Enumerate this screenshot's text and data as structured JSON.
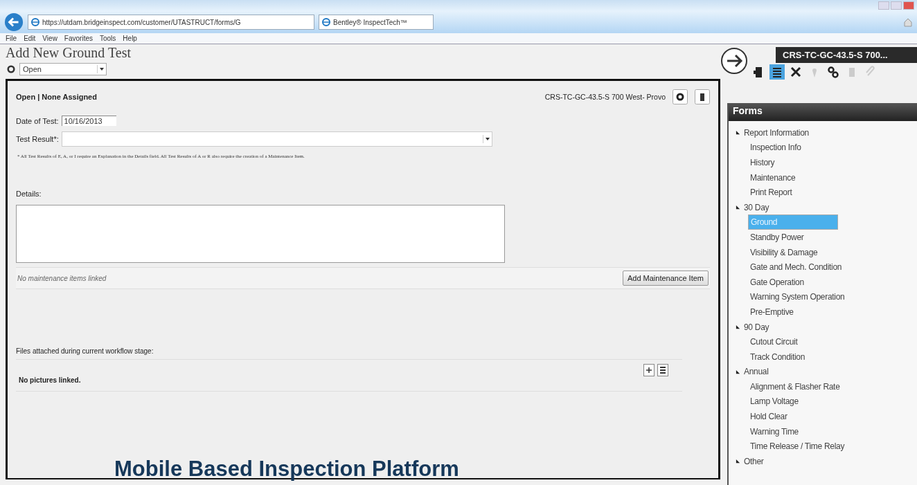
{
  "browser": {
    "address": "https://utdam.bridgeinspect.com/customer/UTASTRUCT/forms/G",
    "tab_title": "Bentley® InspectTech™",
    "menu": [
      "File",
      "Edit",
      "View",
      "Favorites",
      "Tools",
      "Help"
    ]
  },
  "page": {
    "title": "Add New Ground Test",
    "status_select": {
      "value": "Open"
    }
  },
  "form": {
    "status": "Open | None Assigned",
    "asset": "CRS-TC-GC-43.5-S 700 West- Provo",
    "date_label": "Date of Test:",
    "date_value": "10/16/2013",
    "result_label": "Test Result*:",
    "note": "* All Test Results of E, A, or I require an Explanation in the Details field. All Test Results of A or R also require the creation of a Maintenance Item.",
    "details_label": "Details:",
    "maintenance_empty": "No maintenance items linked",
    "add_button": "Add Maintenance Item",
    "files_label": "Files attached during current workflow stage:",
    "pictures_empty": "No pictures linked."
  },
  "sidebar": {
    "asset_title": "CRS-TC-GC-43.5-S 700...",
    "toolbar": [
      {
        "kind": "door",
        "selected": false
      },
      {
        "kind": "list",
        "selected": true
      },
      {
        "kind": "tools",
        "selected": false
      },
      {
        "kind": "pin",
        "selected": false
      },
      {
        "kind": "keys",
        "selected": false
      },
      {
        "kind": "trash",
        "selected": false
      },
      {
        "kind": "clip",
        "selected": false
      }
    ],
    "panel_title": "Forms",
    "tree": [
      {
        "label": "Report Information",
        "expanded": true,
        "children": [
          {
            "label": "Inspection Info",
            "selected": false
          },
          {
            "label": "History",
            "selected": false
          },
          {
            "label": "Maintenance",
            "selected": false
          },
          {
            "label": "Print Report",
            "selected": false
          }
        ]
      },
      {
        "label": "30 Day",
        "expanded": true,
        "children": [
          {
            "label": "Ground",
            "selected": true
          },
          {
            "label": "Standby Power",
            "selected": false
          },
          {
            "label": "Visibility & Damage",
            "selected": false
          },
          {
            "label": "Gate and Mech. Condition",
            "selected": false
          },
          {
            "label": "Gate Operation",
            "selected": false
          },
          {
            "label": "Warning System Operation",
            "selected": false
          },
          {
            "label": "Pre-Emptive",
            "selected": false
          }
        ]
      },
      {
        "label": "90 Day",
        "expanded": true,
        "children": [
          {
            "label": "Cutout Circuit",
            "selected": false
          },
          {
            "label": "Track Condition",
            "selected": false
          }
        ]
      },
      {
        "label": "Annual",
        "expanded": true,
        "children": [
          {
            "label": "Alignment & Flasher Rate",
            "selected": false
          },
          {
            "label": "Lamp Voltage",
            "selected": false
          },
          {
            "label": "Hold Clear",
            "selected": false
          },
          {
            "label": "Warning Time",
            "selected": false
          },
          {
            "label": "Time Release / Time Relay",
            "selected": false
          }
        ]
      },
      {
        "label": "Other",
        "expanded": true
      }
    ]
  },
  "caption": "Mobile Based Inspection Platform"
}
